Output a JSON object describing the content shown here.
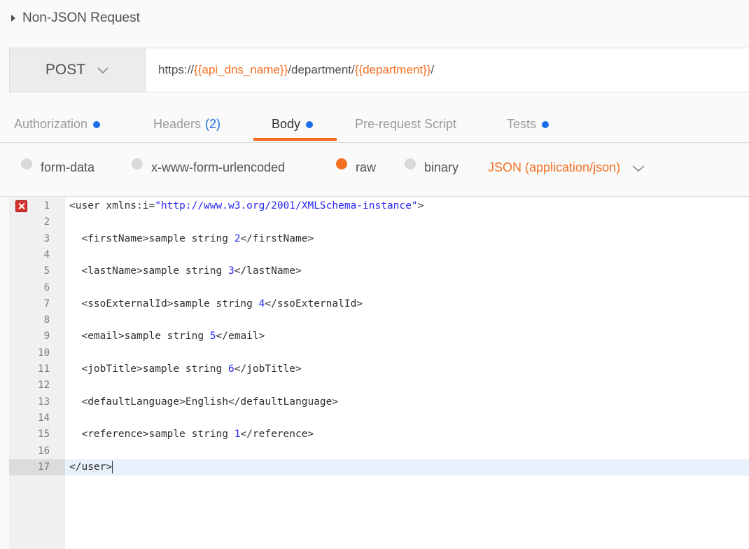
{
  "request": {
    "name": "Non-JSON Request",
    "method": "POST",
    "url_parts": [
      {
        "text": "https://",
        "var": false
      },
      {
        "text": "{{api_dns_name}}",
        "var": true
      },
      {
        "text": "/department/",
        "var": false
      },
      {
        "text": "{{department}}",
        "var": true
      },
      {
        "text": "/",
        "var": false
      }
    ]
  },
  "tabs": [
    {
      "label": "Authorization",
      "dot": true,
      "count": ""
    },
    {
      "label": "Headers",
      "dot": false,
      "count": "(2)"
    },
    {
      "label": "Body",
      "dot": true,
      "count": "",
      "active": true
    },
    {
      "label": "Pre-request Script",
      "dot": false,
      "count": ""
    },
    {
      "label": "Tests",
      "dot": true,
      "count": ""
    }
  ],
  "body_types": [
    {
      "label": "form-data",
      "selected": false
    },
    {
      "label": "x-www-form-urlencoded",
      "selected": false
    },
    {
      "label": "raw",
      "selected": true
    },
    {
      "label": "binary",
      "selected": false
    }
  ],
  "content_type": "JSON (application/json)",
  "editor": {
    "error_line": 1,
    "current_line": 17,
    "lines": [
      "<user xmlns:i=\"http://www.w3.org/2001/XMLSchema-instance\">",
      "",
      "  <firstName>sample string 2</firstName>",
      "",
      "  <lastName>sample string 3</lastName>",
      "",
      "  <ssoExternalId>sample string 4</ssoExternalId>",
      "",
      "  <email>sample string 5</email>",
      "",
      "  <jobTitle>sample string 6</jobTitle>",
      "",
      "  <defaultLanguage>English</defaultLanguage>",
      "",
      "  <reference>sample string 1</reference>",
      "",
      "</user>"
    ]
  },
  "colors": {
    "accent": "#f47023",
    "dot_blue": "#1c6fe8",
    "error_red": "#d9302b"
  }
}
